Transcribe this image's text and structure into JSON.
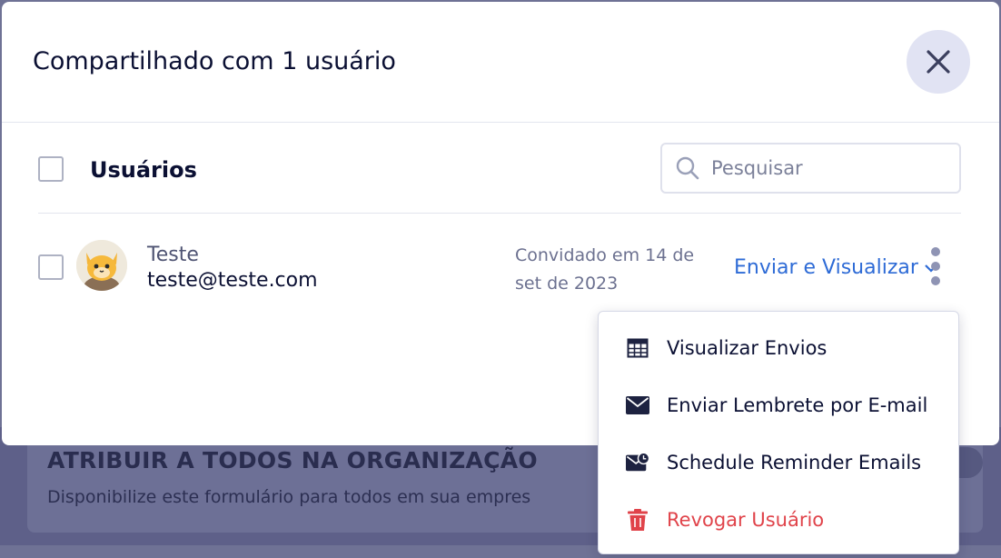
{
  "background": {
    "section_title": "ATRIBUIR A TODOS NA ORGANIZAÇÃO",
    "section_description": "Disponibilize este formulário para todos em sua empres"
  },
  "modal": {
    "title": "Compartilhado com 1 usuário",
    "close_icon": "close-icon"
  },
  "users_list": {
    "heading": "Usuários",
    "search": {
      "placeholder": "Pesquisar",
      "value": ""
    },
    "rows": [
      {
        "name": "Teste",
        "email": "teste@teste.com",
        "invited_line1": "Convidado em 14 de",
        "invited_line2": "set de 2023",
        "permission": "Enviar e Visualizar"
      }
    ]
  },
  "row_menu": {
    "items": [
      {
        "label": "Visualizar Envios",
        "icon": "table-icon"
      },
      {
        "label": "Enviar Lembrete por E-mail",
        "icon": "envelope-icon"
      },
      {
        "label": "Schedule Reminder Emails",
        "icon": "envelope-clock-icon"
      },
      {
        "label": "Revogar Usuário",
        "icon": "trash-icon"
      }
    ]
  },
  "colors": {
    "link": "#2e6bd6",
    "danger": "#e0434a",
    "text_primary": "#0b1033",
    "close_button_bg": "#e1e3f3"
  }
}
